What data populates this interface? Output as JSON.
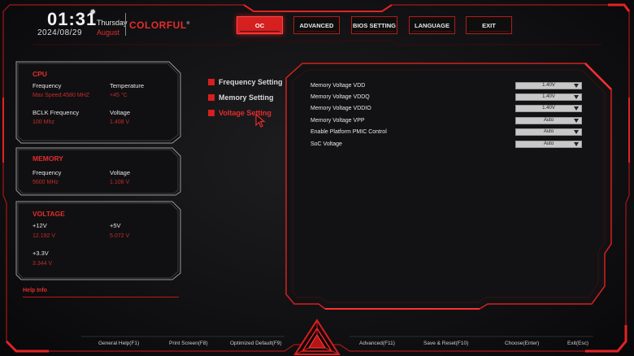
{
  "header": {
    "time": "01:31",
    "day": "Thursday",
    "date": "2024/08/29",
    "month": "August",
    "brand": "COLORFUL",
    "brand_mark": "®"
  },
  "tabs": [
    "OC",
    "ADVANCED",
    "BIOS SETTING",
    "LANGUAGE",
    "EXIT"
  ],
  "active_tab": "OC",
  "cpu": {
    "title": "CPU",
    "frequency_label": "Frequency",
    "frequency_value": "Max Speed:4580 MHZ",
    "temperature_label": "Temperature",
    "temperature_value": "+45 °C",
    "bclk_label": "BCLK Frequency",
    "bclk_value": "100 Mhz",
    "voltage_label": "Voltage",
    "voltage_value": "1.408 V"
  },
  "memory": {
    "title": "MEMORY",
    "frequency_label": "Frequency",
    "frequency_value": "5600 MHz",
    "voltage_label": "Voltage",
    "voltage_value": "1.108 V"
  },
  "voltage": {
    "title": "VOLTAGE",
    "v12_label": "+12V",
    "v12_value": "12.192 V",
    "v5_label": "+5V",
    "v5_value": "5.072 V",
    "v33_label": "+3.3V",
    "v33_value": "3.344 V"
  },
  "help_label": "Help Info",
  "menu": [
    "Frequency Setting",
    "Memory Setting",
    "Voltage Setting"
  ],
  "menu_active_index": 2,
  "settings": [
    {
      "label": "Memory Voltage VDD",
      "value": "1.40V"
    },
    {
      "label": "Memory Voltage VDDQ",
      "value": "1.40V"
    },
    {
      "label": "Memory Voltage VDDIO",
      "value": "1.40V"
    },
    {
      "label": "Memory Voltage VPP",
      "value": "Auto"
    },
    {
      "label": "Enable Platform PMIC Control",
      "value": "Auto"
    },
    {
      "label": "SoC Voltage",
      "value": "Auto"
    }
  ],
  "footer": {
    "general_help": "General Help(F1)",
    "print_screen": "Print Screen(F8)",
    "optimized_default": "Optimized Default(F9)",
    "advanced": "Advanced(F11)",
    "save_reset": "Save & Reset(F10)",
    "choose": "Choose(Enter)",
    "exit": "Exit(Esc)"
  },
  "colors": {
    "accent": "#d61f1f",
    "value_text": "#c62a2a",
    "background": "#141416"
  }
}
